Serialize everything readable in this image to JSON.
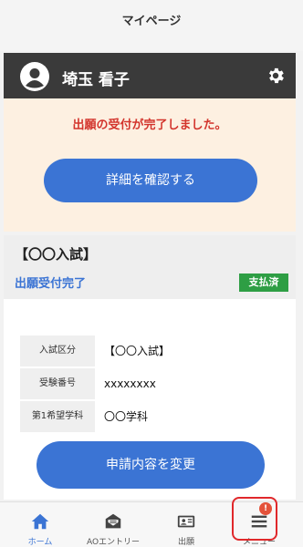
{
  "header": {
    "title": "マイページ"
  },
  "user": {
    "name": "埼玉 看子"
  },
  "notice": {
    "message": "出願の受付が完了しました。",
    "detail_button": "詳細を確認する"
  },
  "application": {
    "exam_name": "【〇〇入試】",
    "status": "出願受付完了",
    "payment_badge": "支払済",
    "info_rows": [
      {
        "label": "入試区分",
        "value": "【〇〇入試】"
      },
      {
        "label": "受験番号",
        "value": "xxxxxxxx"
      },
      {
        "label": "第1希望学科",
        "value": "〇〇学科"
      }
    ],
    "change_button": "申請内容を変更"
  },
  "bottom_nav": {
    "items": [
      {
        "label": "ホーム",
        "icon": "home-icon",
        "active": true
      },
      {
        "label": "AOエントリー",
        "icon": "envelope-icon",
        "active": false
      },
      {
        "label": "出願",
        "icon": "id-card-icon",
        "active": false
      },
      {
        "label": "メニュー",
        "icon": "menu-icon",
        "active": false
      }
    ],
    "menu_badge": "!"
  },
  "colors": {
    "accent": "#3b74d4",
    "alert": "#d3342c",
    "paid": "#2e9e44",
    "user_bar": "#3a3a3a",
    "notice_bg": "#fdf0e1"
  }
}
